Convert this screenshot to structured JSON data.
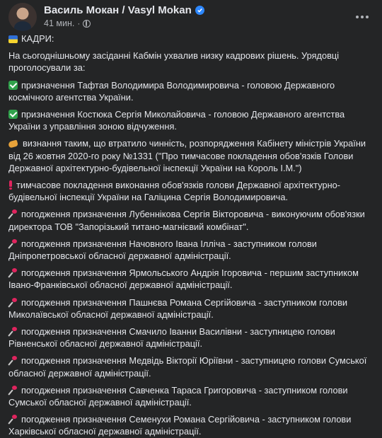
{
  "author": {
    "name": "Василь Мокан / Vasyl Mokan",
    "time": "41 мин."
  },
  "paragraphs": [
    {
      "icon": "ukraine-flag-icon",
      "text": "КАДРИ:"
    },
    {
      "icon": "",
      "text": "На сьогоднішньому засіданні Кабмін ухвалив низку кадрових рішень. Урядовці проголосували за:"
    },
    {
      "icon": "check-mark-icon",
      "text": "призначення Тафтая Володимира Володимировича - головою Державного космічного агентства України."
    },
    {
      "icon": "check-mark-icon",
      "text": "призначення Костюка Сергія Миколайовича - головою Державного агентства України з управління зоною відчуження."
    },
    {
      "icon": "flexed-arm-icon",
      "text": "визнання таким, що втратило чинність, розпорядження Кабінету міністрів України від 26 жовтня 2020-го року №1331 (\"Про тимчасове покладення обов'язків Голови Державної архітектурно-будівельної інспекції України на Король І.М.\")"
    },
    {
      "icon": "exclamation-icon",
      "text": "тимчасове покладення виконання обов'язків голови Державної архітектурно-будівельної інспекції України на Галіцина Сергія Володимировича."
    },
    {
      "icon": "pushpin-icon",
      "text": "погодження призначення Лубеннікова Сергія Вікторовича - виконуючим обов'язки директора ТОВ \"Запорізький титано-магнієвий комбінат\"."
    },
    {
      "icon": "pushpin-icon",
      "text": "погодження призначення Начовного Івана Ілліча - заступником голови Дніпропетровської обласної державної адміністрації."
    },
    {
      "icon": "pushpin-icon",
      "text": "погодження призначення Ярмольського Андрія Ігоровича - першим заступником Івано-Франківської обласної державної адміністрації."
    },
    {
      "icon": "pushpin-icon",
      "text": "погодження призначення Пашнєва Романа Сергійовича - заступником голови Миколаївської обласної державної адміністрації."
    },
    {
      "icon": "pushpin-icon",
      "text": "погодження призначення Смачило Іванни Василівни - заступницею голови Рівненської обласної державної адміністрації."
    },
    {
      "icon": "pushpin-icon",
      "text": "погодження призначення Медвідь Вікторії Юріївни - заступницею голови Сумської обласної державної адміністрації."
    },
    {
      "icon": "pushpin-icon",
      "text": "погодження призначення Савченка Тараса Григоровича - заступником голови Сумської обласної державної адміністрації."
    },
    {
      "icon": "pushpin-icon",
      "text": "погодження призначення Семенухи Романа Сергійовича - заступником голови Харківської обласної державної адміністрації."
    }
  ]
}
